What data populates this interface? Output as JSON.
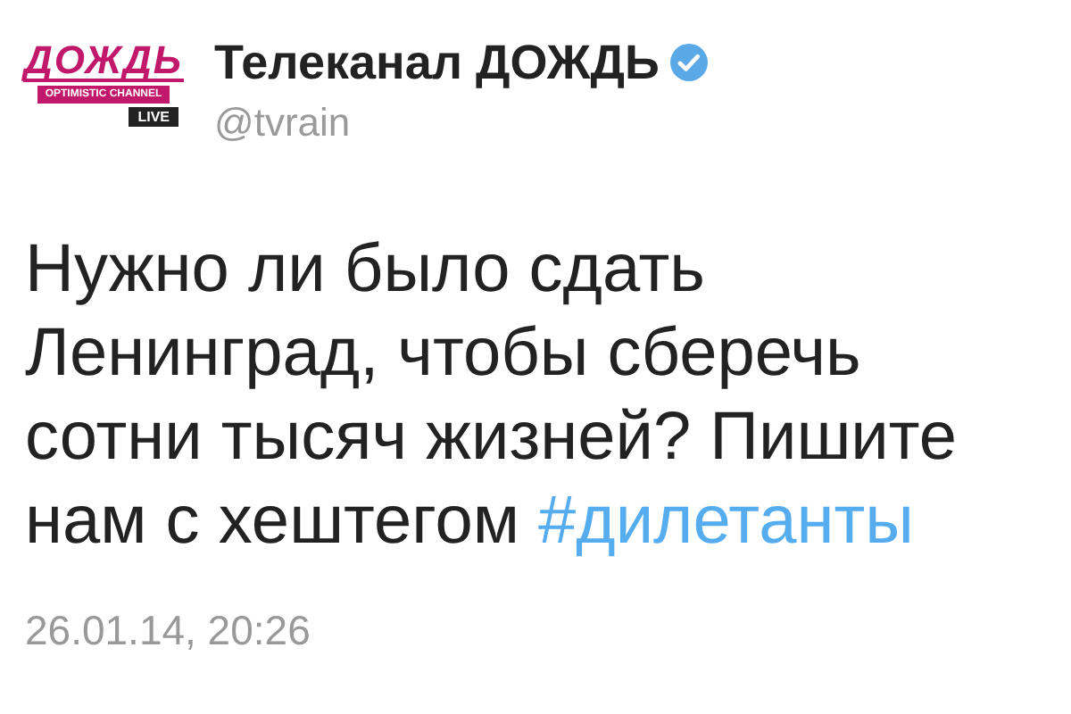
{
  "account": {
    "logo": {
      "wordmark": "ДОЖДЬ",
      "tagline": "OPTIMISTIC CHANNEL",
      "badge": "LIVE"
    },
    "name": "Телеканал ДОЖДЬ",
    "verified": true,
    "handle": "@tvrain"
  },
  "tweet": {
    "parts": [
      {
        "kind": "text",
        "text": "Нужно ли было сдать\nЛенинград, чтобы сберечь\nсотни тысяч жизней? Пишите\nнам с хештегом "
      },
      {
        "kind": "hashtag",
        "text": "#дилетанты"
      }
    ],
    "timestamp": "26.01.14, 20:26"
  }
}
